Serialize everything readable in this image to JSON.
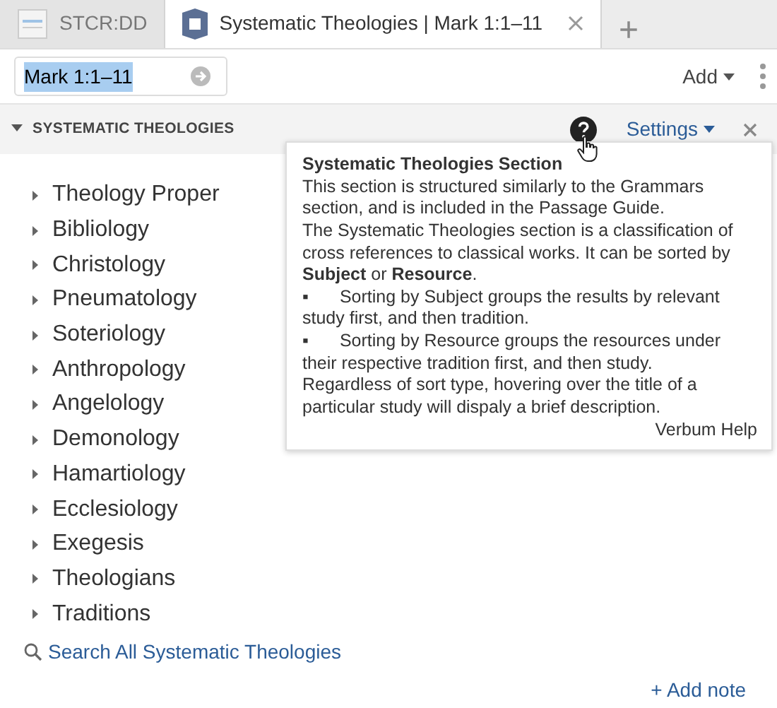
{
  "tabs": [
    {
      "label": "STCR:DD",
      "kind": "document",
      "selected": false,
      "closable": false
    },
    {
      "label": "Systematic Theologies | Mark 1:1–11",
      "kind": "guide",
      "selected": true,
      "closable": true
    }
  ],
  "new_tab": "+",
  "toolbar": {
    "reference": "Mark 1:1–11",
    "add": "Add"
  },
  "section": {
    "title": "SYSTEMATIC THEOLOGIES",
    "expanded": true,
    "settings": "Settings"
  },
  "tree": [
    {
      "label": "Theology Proper",
      "expanded": false
    },
    {
      "label": "Bibliology",
      "expanded": false
    },
    {
      "label": "Christology",
      "expanded": false
    },
    {
      "label": "Pneumatology",
      "expanded": false
    },
    {
      "label": "Soteriology",
      "expanded": false
    },
    {
      "label": "Anthropology",
      "expanded": false
    },
    {
      "label": "Angelology",
      "expanded": false
    },
    {
      "label": "Demonology",
      "expanded": false
    },
    {
      "label": "Hamartiology",
      "expanded": false
    },
    {
      "label": "Ecclesiology",
      "expanded": false
    },
    {
      "label": "Exegesis",
      "expanded": false
    },
    {
      "label": "Theologians",
      "expanded": false
    },
    {
      "label": "Traditions",
      "expanded": false
    }
  ],
  "search_link": "Search All Systematic Theologies",
  "add_note": "+ Add note",
  "tooltip": {
    "title": "Systematic Theologies Section",
    "lines": [
      {
        "kind": "text",
        "text": "This section is structured similarly to the Grammars section, and is included in the Passage Guide."
      },
      {
        "kind": "text",
        "text": "The Systematic Theologies section is a classification of cross references to classical works. It can be sorted by **Subject** or **Resource**."
      },
      {
        "kind": "bullet",
        "marker": "▪",
        "text": "Sorting by Subject groups the results by relevant study first, and then tradition."
      },
      {
        "kind": "bullet",
        "marker": "▪",
        "text": "Sorting by Resource groups the resources under their respective tradition first, and then study."
      },
      {
        "kind": "text",
        "text": "Regardless of sort type, hovering over the title of a particular study will dispaly a brief description."
      }
    ],
    "link": "Verbum Help"
  }
}
